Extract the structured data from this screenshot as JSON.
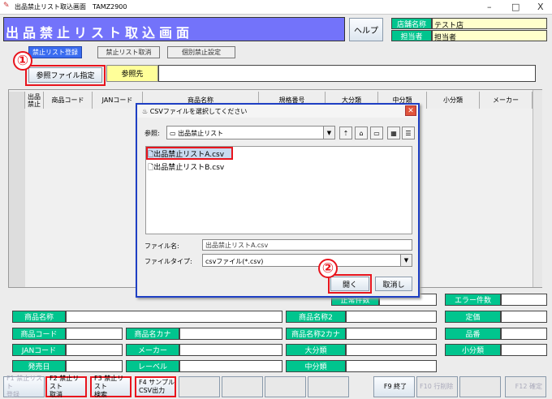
{
  "window": {
    "title": "出品禁止リスト取込画面　TAMZ2900",
    "minimize": "–",
    "maximize": "□",
    "close": "X"
  },
  "header": {
    "title": "出品禁止リスト取込画面",
    "help_label": "ヘルプ",
    "store_label": "店舗名称",
    "store_value": "テスト店",
    "staff_label": "担当者",
    "staff_value": "担当者"
  },
  "tabs": [
    {
      "label": "禁止リスト登録",
      "active": true
    },
    {
      "label": "禁止リスト取消"
    },
    {
      "label": "個別禁止設定"
    }
  ],
  "annotations": {
    "step1": "①",
    "step2": "②"
  },
  "reference": {
    "button_label": "参照ファイル指定",
    "label": "参照先",
    "value": ""
  },
  "table": {
    "columns": [
      "出品禁止",
      "商品コード",
      "JANコード",
      "商品名称",
      "規格番号",
      "大分類",
      "中分類",
      "小分類",
      "メーカー"
    ]
  },
  "dialog": {
    "title": "CSVファイルを選択してください",
    "look_in_label": "参照:",
    "look_in_value": "出品禁止リスト",
    "files": [
      "出品禁止リストA.csv",
      "出品禁止リストB.csv"
    ],
    "selected_file": "出品禁止リストA.csv",
    "filename_label": "ファイル名:",
    "filename_value": "出品禁止リストA.csv",
    "filetype_label": "ファイルタイプ:",
    "filetype_value": "csvファイル(*.csv)",
    "open_label": "開く",
    "cancel_label": "取消し"
  },
  "counts": {
    "normal_label": "正常件数",
    "normal_value": "",
    "error_label": "エラー件数",
    "error_value": ""
  },
  "fields": {
    "col1": [
      "商品名称",
      "商品コード",
      "JANコード",
      "発売日"
    ],
    "col2": [
      "商品名カナ",
      "メーカー",
      "レーベル"
    ],
    "col3": [
      "商品名称2",
      "商品名称2カナ",
      "大分類",
      "中分類"
    ],
    "col4": [
      "定価",
      "品番",
      "小分類"
    ]
  },
  "fkeys": {
    "f1": "F1 禁止リスト\n登録",
    "f2": "F2 禁止リスト\n取消",
    "f3": "F3 禁止リスト\n検索",
    "f4": "F4 サンプル\nCSV出力",
    "f9": "F9 終了",
    "f10": "F10 行削除",
    "f11": "",
    "f12": "F12 確定"
  },
  "colors": {
    "banner": "#7373fa",
    "label_green": "#00c58e",
    "value_yellow": "#ffffcc",
    "tab_active": "#3a6cf0",
    "highlight_red": "#e8141d"
  }
}
